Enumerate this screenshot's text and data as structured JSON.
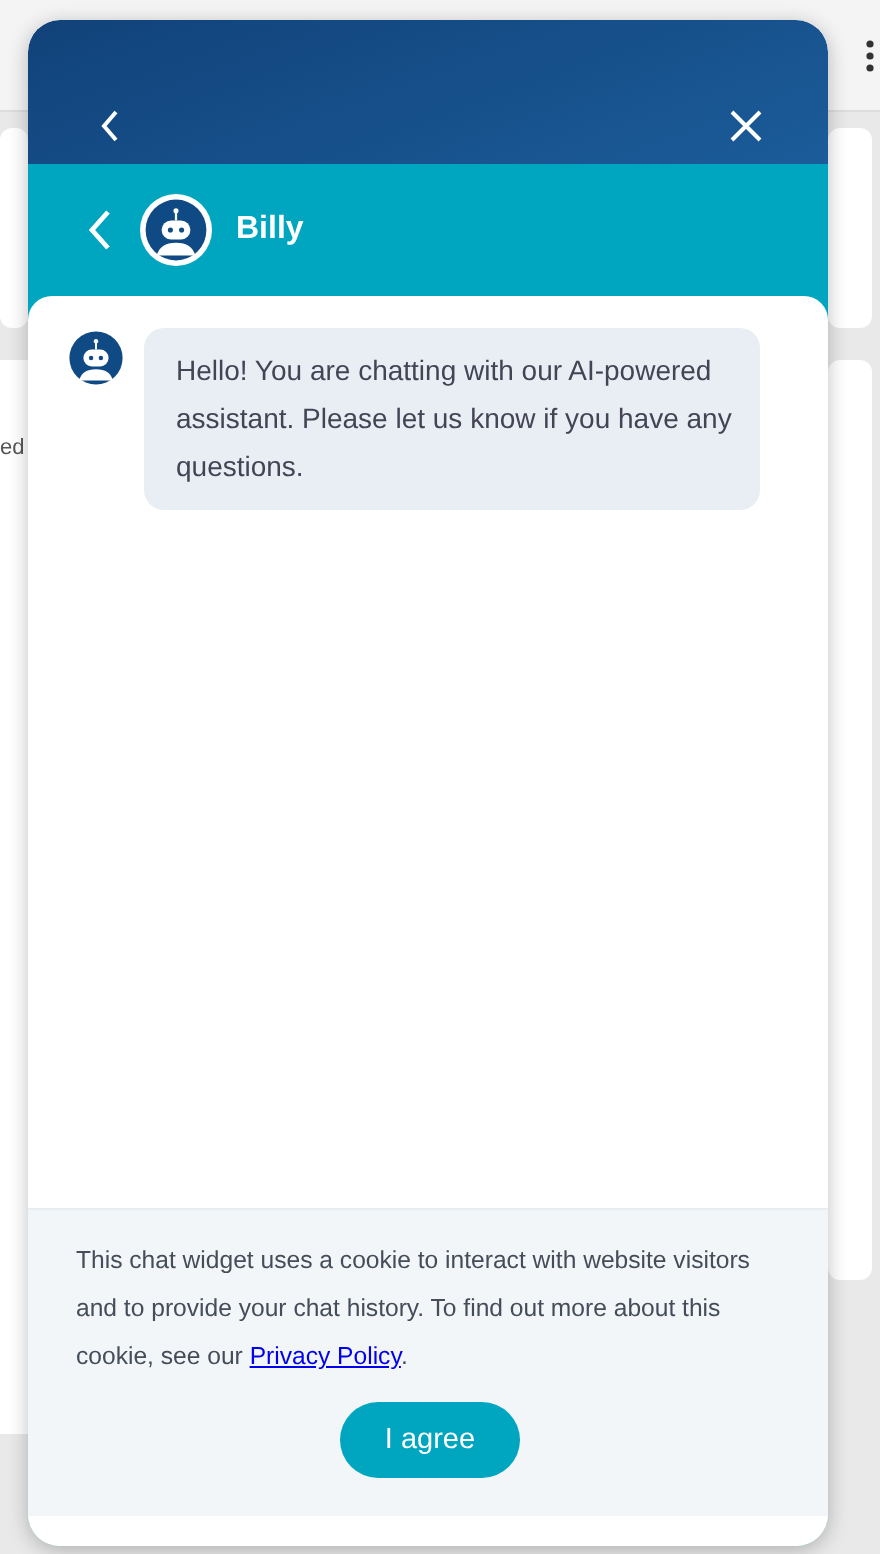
{
  "background": {
    "text_fragment": "ed"
  },
  "chat": {
    "agent_name": "Billy",
    "messages": [
      {
        "kind": "bot",
        "text": "Hello! You are chatting with our AI-powered assistant. Please let us know if you have any questions."
      }
    ]
  },
  "cookie_notice": {
    "text_before": "This chat widget uses a cookie to interact with website visitors and to provide your chat history. To find out more about this cookie, see our ",
    "link": "Privacy Policy",
    "text_after": ".",
    "button": "I agree"
  }
}
